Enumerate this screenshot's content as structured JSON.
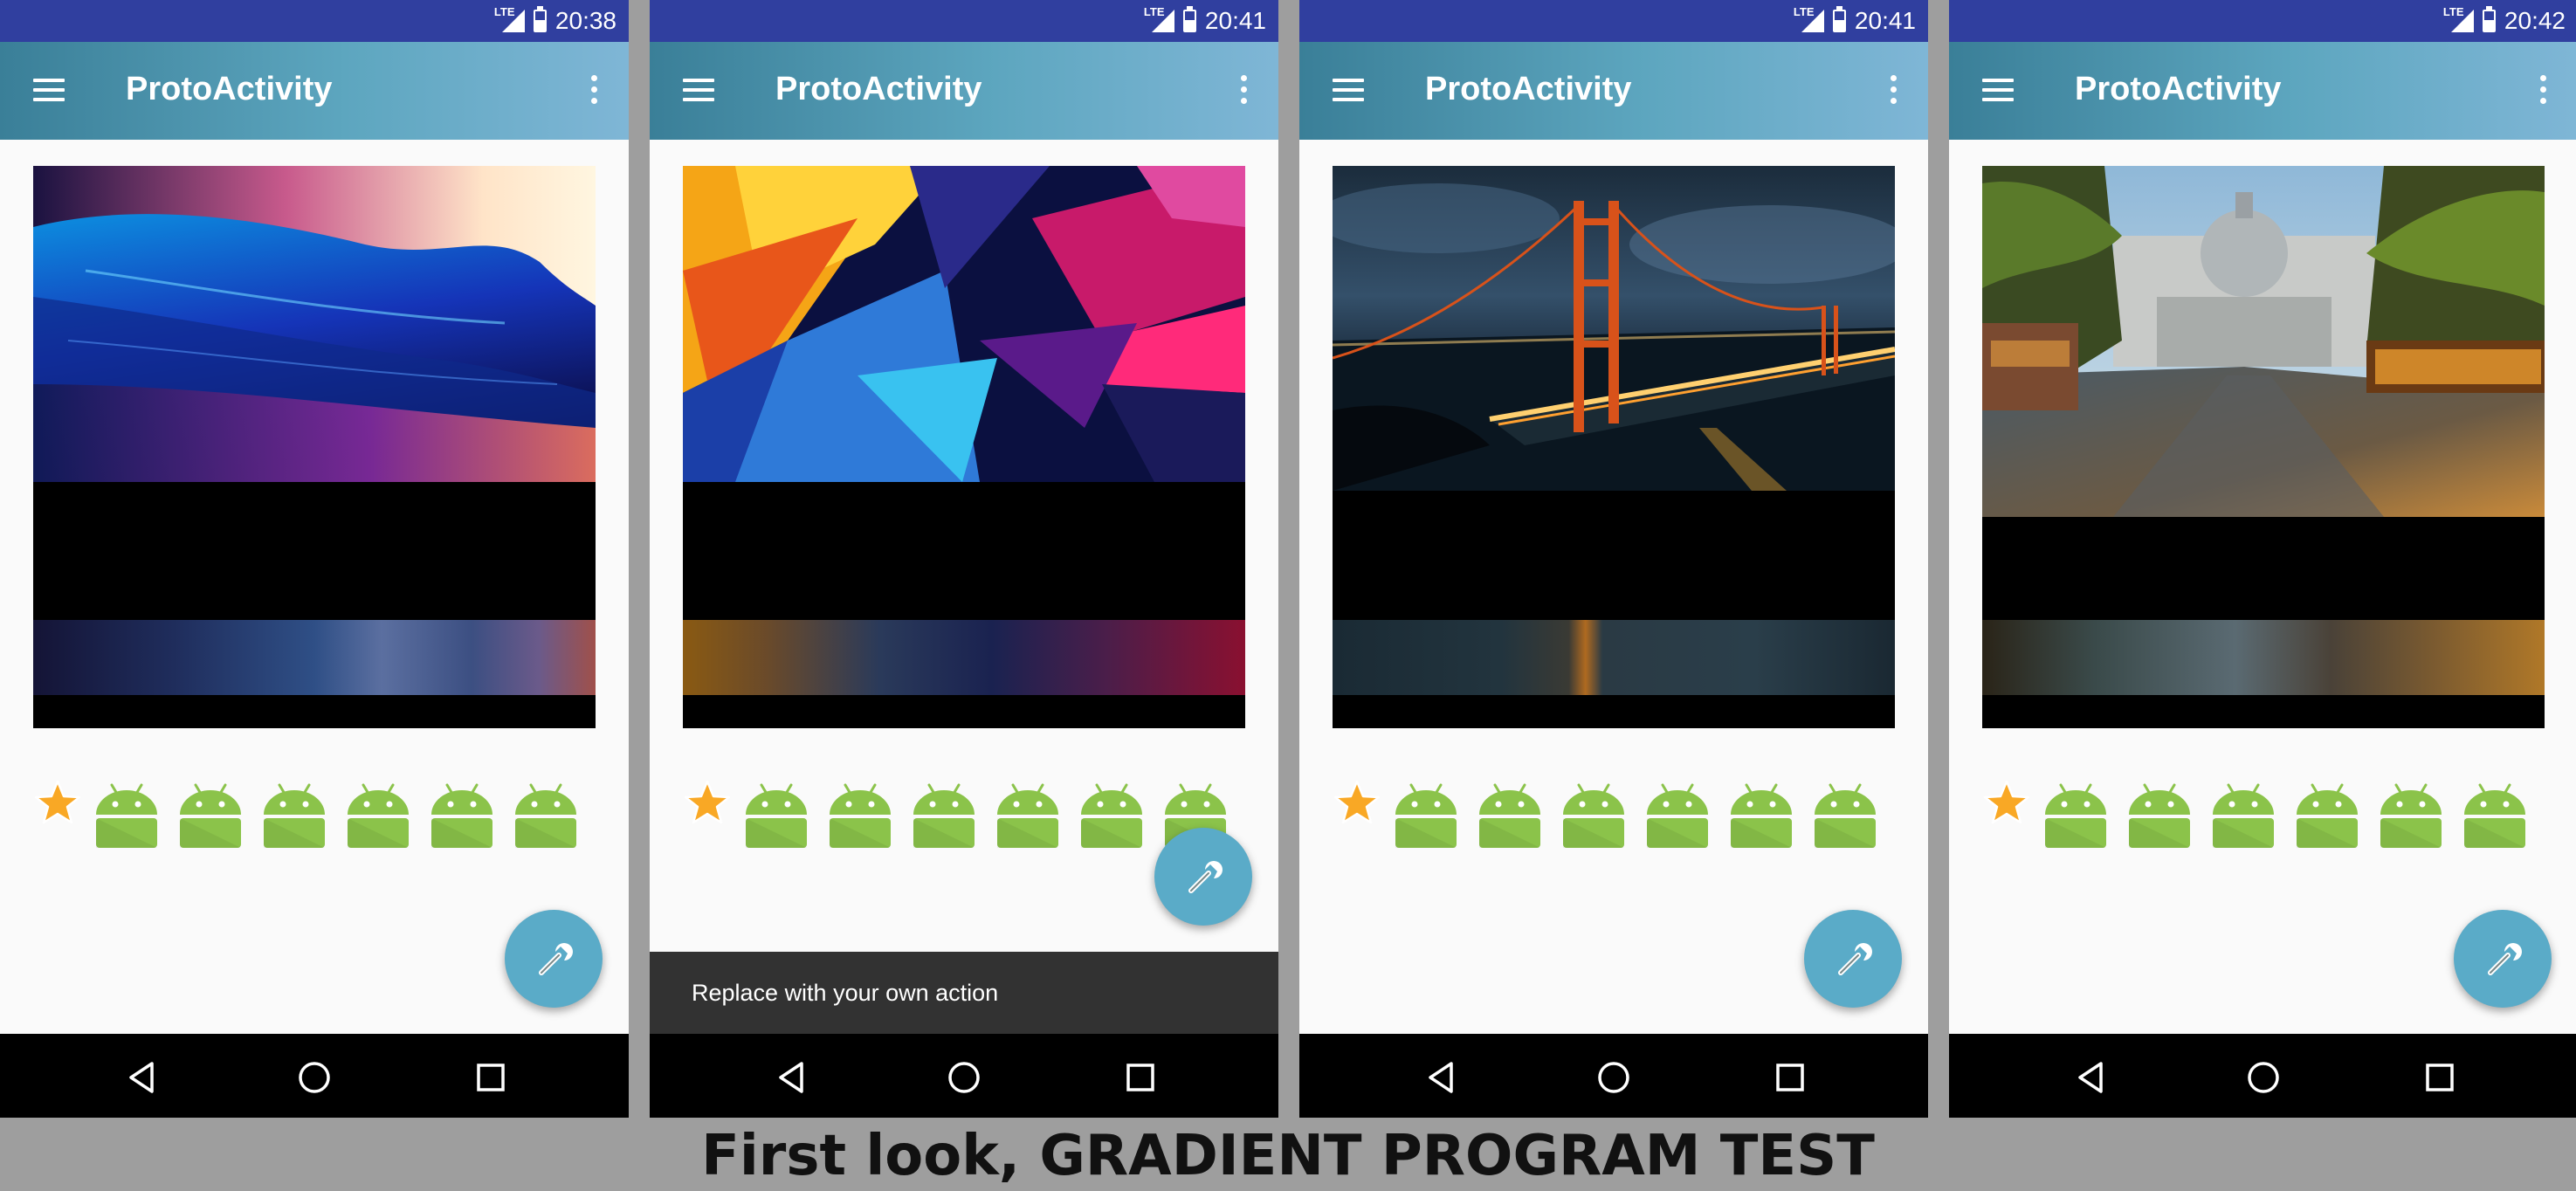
{
  "caption": "First look, GRADIENT PROGRAM TEST",
  "icons": {
    "menu": "hamburger-menu-icon",
    "overflow": "overflow-menu-icon",
    "favorite": "star-icon",
    "app": "android-robot-icon",
    "fab": "wrench-icon",
    "back": "back-triangle-icon",
    "home": "home-circle-icon",
    "recents": "recents-square-icon",
    "signal": "lte-signal-icon",
    "battery": "battery-icon"
  },
  "colors": {
    "status_bar": "#303f9f",
    "fab": "#5aabc8",
    "android_green": "#8bc34a",
    "star": "#f9a825"
  },
  "screens": [
    {
      "status_network": "LTE",
      "time": "20:38",
      "app_title": "ProtoActivity",
      "image": "abstract blue wave",
      "snackbar": null,
      "fab_raised": false
    },
    {
      "status_network": "LTE",
      "time": "20:41",
      "app_title": "ProtoActivity",
      "image": "abstract polygon shards",
      "snackbar": "Replace with your own action",
      "fab_raised": true
    },
    {
      "status_network": "LTE",
      "time": "20:41",
      "app_title": "ProtoActivity",
      "image": "golden gate bridge at night",
      "snackbar": null,
      "fab_raised": false
    },
    {
      "status_network": "LTE",
      "time": "20:42",
      "app_title": "ProtoActivity",
      "image": "street with cafe and domed building",
      "snackbar": null,
      "fab_raised": false
    }
  ]
}
